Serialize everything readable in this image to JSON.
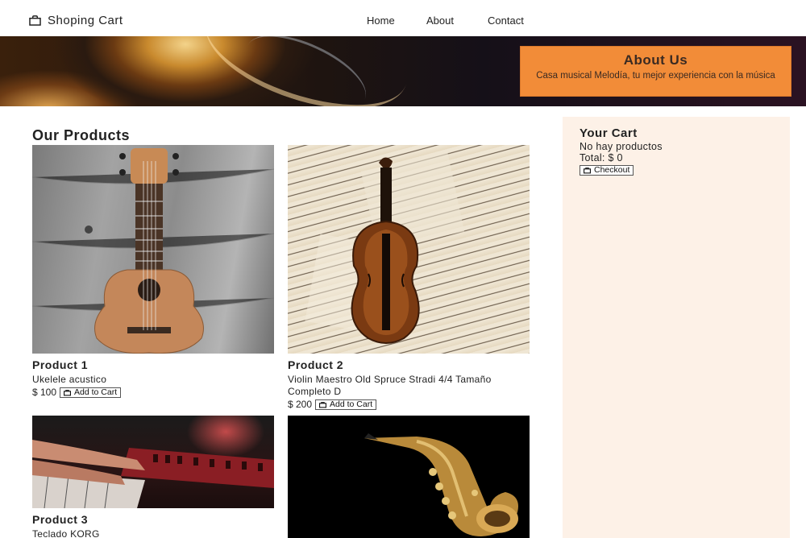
{
  "header": {
    "brand": "Shoping Cart",
    "nav": [
      "Home",
      "About",
      "Contact"
    ]
  },
  "hero": {
    "title": "About Us",
    "text": "Casa musical Melodía, tu mejor experiencia con la música",
    "box_color": "#f28c38"
  },
  "products": {
    "title": "Our Products",
    "items": [
      {
        "name": "Product 1",
        "desc": "Ukelele acustico",
        "price": "$ 100",
        "button": "Add to Cart",
        "image": "ukulele"
      },
      {
        "name": "Product 2",
        "desc": "Violin Maestro Old Spruce Stradi 4/4 Tamaño Completo D",
        "price": "$ 200",
        "button": "Add to Cart",
        "image": "violin"
      },
      {
        "name": "Product 3",
        "desc": "Teclado KORG",
        "image": "keyboard"
      },
      {
        "image": "saxophone"
      }
    ]
  },
  "cart": {
    "title": "Your Cart",
    "empty": "No hay productos",
    "total": "Total: $ 0",
    "checkout": "Checkout",
    "bg_color": "#fdf1e7"
  },
  "icons": {
    "bag": "shopping-bag-icon"
  }
}
